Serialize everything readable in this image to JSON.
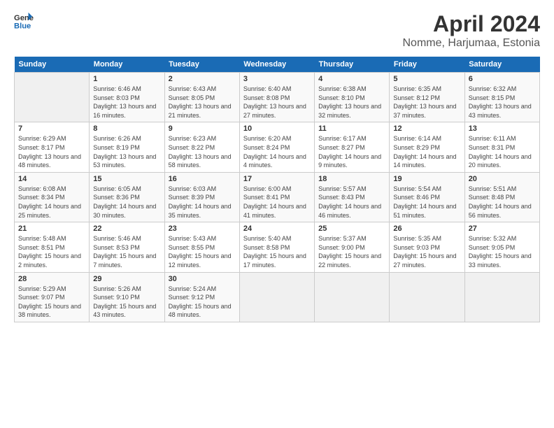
{
  "logo": {
    "line1": "General",
    "line2": "Blue"
  },
  "title": "April 2024",
  "subtitle": "Nomme, Harjumaa, Estonia",
  "headers": [
    "Sunday",
    "Monday",
    "Tuesday",
    "Wednesday",
    "Thursday",
    "Friday",
    "Saturday"
  ],
  "weeks": [
    [
      {
        "day": "",
        "sunrise": "",
        "sunset": "",
        "daylight": ""
      },
      {
        "day": "1",
        "sunrise": "Sunrise: 6:46 AM",
        "sunset": "Sunset: 8:03 PM",
        "daylight": "Daylight: 13 hours and 16 minutes."
      },
      {
        "day": "2",
        "sunrise": "Sunrise: 6:43 AM",
        "sunset": "Sunset: 8:05 PM",
        "daylight": "Daylight: 13 hours and 21 minutes."
      },
      {
        "day": "3",
        "sunrise": "Sunrise: 6:40 AM",
        "sunset": "Sunset: 8:08 PM",
        "daylight": "Daylight: 13 hours and 27 minutes."
      },
      {
        "day": "4",
        "sunrise": "Sunrise: 6:38 AM",
        "sunset": "Sunset: 8:10 PM",
        "daylight": "Daylight: 13 hours and 32 minutes."
      },
      {
        "day": "5",
        "sunrise": "Sunrise: 6:35 AM",
        "sunset": "Sunset: 8:12 PM",
        "daylight": "Daylight: 13 hours and 37 minutes."
      },
      {
        "day": "6",
        "sunrise": "Sunrise: 6:32 AM",
        "sunset": "Sunset: 8:15 PM",
        "daylight": "Daylight: 13 hours and 43 minutes."
      }
    ],
    [
      {
        "day": "7",
        "sunrise": "Sunrise: 6:29 AM",
        "sunset": "Sunset: 8:17 PM",
        "daylight": "Daylight: 13 hours and 48 minutes."
      },
      {
        "day": "8",
        "sunrise": "Sunrise: 6:26 AM",
        "sunset": "Sunset: 8:19 PM",
        "daylight": "Daylight: 13 hours and 53 minutes."
      },
      {
        "day": "9",
        "sunrise": "Sunrise: 6:23 AM",
        "sunset": "Sunset: 8:22 PM",
        "daylight": "Daylight: 13 hours and 58 minutes."
      },
      {
        "day": "10",
        "sunrise": "Sunrise: 6:20 AM",
        "sunset": "Sunset: 8:24 PM",
        "daylight": "Daylight: 14 hours and 4 minutes."
      },
      {
        "day": "11",
        "sunrise": "Sunrise: 6:17 AM",
        "sunset": "Sunset: 8:27 PM",
        "daylight": "Daylight: 14 hours and 9 minutes."
      },
      {
        "day": "12",
        "sunrise": "Sunrise: 6:14 AM",
        "sunset": "Sunset: 8:29 PM",
        "daylight": "Daylight: 14 hours and 14 minutes."
      },
      {
        "day": "13",
        "sunrise": "Sunrise: 6:11 AM",
        "sunset": "Sunset: 8:31 PM",
        "daylight": "Daylight: 14 hours and 20 minutes."
      }
    ],
    [
      {
        "day": "14",
        "sunrise": "Sunrise: 6:08 AM",
        "sunset": "Sunset: 8:34 PM",
        "daylight": "Daylight: 14 hours and 25 minutes."
      },
      {
        "day": "15",
        "sunrise": "Sunrise: 6:05 AM",
        "sunset": "Sunset: 8:36 PM",
        "daylight": "Daylight: 14 hours and 30 minutes."
      },
      {
        "day": "16",
        "sunrise": "Sunrise: 6:03 AM",
        "sunset": "Sunset: 8:39 PM",
        "daylight": "Daylight: 14 hours and 35 minutes."
      },
      {
        "day": "17",
        "sunrise": "Sunrise: 6:00 AM",
        "sunset": "Sunset: 8:41 PM",
        "daylight": "Daylight: 14 hours and 41 minutes."
      },
      {
        "day": "18",
        "sunrise": "Sunrise: 5:57 AM",
        "sunset": "Sunset: 8:43 PM",
        "daylight": "Daylight: 14 hours and 46 minutes."
      },
      {
        "day": "19",
        "sunrise": "Sunrise: 5:54 AM",
        "sunset": "Sunset: 8:46 PM",
        "daylight": "Daylight: 14 hours and 51 minutes."
      },
      {
        "day": "20",
        "sunrise": "Sunrise: 5:51 AM",
        "sunset": "Sunset: 8:48 PM",
        "daylight": "Daylight: 14 hours and 56 minutes."
      }
    ],
    [
      {
        "day": "21",
        "sunrise": "Sunrise: 5:48 AM",
        "sunset": "Sunset: 8:51 PM",
        "daylight": "Daylight: 15 hours and 2 minutes."
      },
      {
        "day": "22",
        "sunrise": "Sunrise: 5:46 AM",
        "sunset": "Sunset: 8:53 PM",
        "daylight": "Daylight: 15 hours and 7 minutes."
      },
      {
        "day": "23",
        "sunrise": "Sunrise: 5:43 AM",
        "sunset": "Sunset: 8:55 PM",
        "daylight": "Daylight: 15 hours and 12 minutes."
      },
      {
        "day": "24",
        "sunrise": "Sunrise: 5:40 AM",
        "sunset": "Sunset: 8:58 PM",
        "daylight": "Daylight: 15 hours and 17 minutes."
      },
      {
        "day": "25",
        "sunrise": "Sunrise: 5:37 AM",
        "sunset": "Sunset: 9:00 PM",
        "daylight": "Daylight: 15 hours and 22 minutes."
      },
      {
        "day": "26",
        "sunrise": "Sunrise: 5:35 AM",
        "sunset": "Sunset: 9:03 PM",
        "daylight": "Daylight: 15 hours and 27 minutes."
      },
      {
        "day": "27",
        "sunrise": "Sunrise: 5:32 AM",
        "sunset": "Sunset: 9:05 PM",
        "daylight": "Daylight: 15 hours and 33 minutes."
      }
    ],
    [
      {
        "day": "28",
        "sunrise": "Sunrise: 5:29 AM",
        "sunset": "Sunset: 9:07 PM",
        "daylight": "Daylight: 15 hours and 38 minutes."
      },
      {
        "day": "29",
        "sunrise": "Sunrise: 5:26 AM",
        "sunset": "Sunset: 9:10 PM",
        "daylight": "Daylight: 15 hours and 43 minutes."
      },
      {
        "day": "30",
        "sunrise": "Sunrise: 5:24 AM",
        "sunset": "Sunset: 9:12 PM",
        "daylight": "Daylight: 15 hours and 48 minutes."
      },
      {
        "day": "",
        "sunrise": "",
        "sunset": "",
        "daylight": ""
      },
      {
        "day": "",
        "sunrise": "",
        "sunset": "",
        "daylight": ""
      },
      {
        "day": "",
        "sunrise": "",
        "sunset": "",
        "daylight": ""
      },
      {
        "day": "",
        "sunrise": "",
        "sunset": "",
        "daylight": ""
      }
    ]
  ]
}
